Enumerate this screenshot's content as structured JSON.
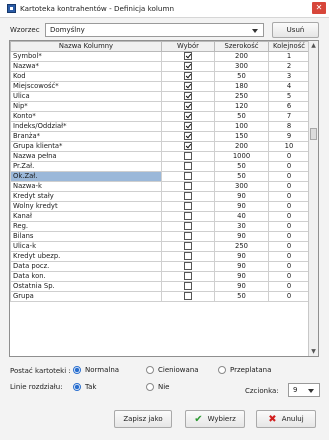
{
  "window": {
    "title": "Kartoteka kontrahentów - Definicja kolumn",
    "close_label": "✕"
  },
  "template": {
    "label": "Wzorzec",
    "value": "Domyślny",
    "delete_button": "Usuń"
  },
  "grid": {
    "headers": [
      "Nazwa Kolumny",
      "Wybór",
      "Szerokość",
      "Kolejność"
    ],
    "rows": [
      {
        "name": "Symbol*",
        "checked": true,
        "width": "200",
        "order": "1"
      },
      {
        "name": "Nazwa*",
        "checked": true,
        "width": "300",
        "order": "2"
      },
      {
        "name": "Kod",
        "checked": true,
        "width": "50",
        "order": "3"
      },
      {
        "name": "Miejscowość*",
        "checked": true,
        "width": "180",
        "order": "4"
      },
      {
        "name": "Ulica",
        "checked": true,
        "width": "250",
        "order": "5"
      },
      {
        "name": "Nip*",
        "checked": true,
        "width": "120",
        "order": "6"
      },
      {
        "name": "Konto*",
        "checked": true,
        "width": "50",
        "order": "7"
      },
      {
        "name": "Indeks/Oddział*",
        "checked": true,
        "width": "100",
        "order": "8"
      },
      {
        "name": "Branża*",
        "checked": true,
        "width": "150",
        "order": "9"
      },
      {
        "name": "Grupa klienta*",
        "checked": true,
        "width": "200",
        "order": "10"
      },
      {
        "name": "Nazwa pełna",
        "checked": false,
        "width": "1000",
        "order": "0"
      },
      {
        "name": "Pr.Zał.",
        "checked": false,
        "width": "50",
        "order": "0"
      },
      {
        "name": "Ok.Zał.",
        "checked": false,
        "width": "50",
        "order": "0",
        "selected": true
      },
      {
        "name": "Nazwa-k",
        "checked": false,
        "width": "300",
        "order": "0"
      },
      {
        "name": "Kredyt stały",
        "checked": false,
        "width": "90",
        "order": "0"
      },
      {
        "name": "Wolny kredyt",
        "checked": false,
        "width": "90",
        "order": "0"
      },
      {
        "name": "Kanał",
        "checked": false,
        "width": "40",
        "order": "0"
      },
      {
        "name": "Reg.",
        "checked": false,
        "width": "30",
        "order": "0"
      },
      {
        "name": "Bilans",
        "checked": false,
        "width": "90",
        "order": "0"
      },
      {
        "name": "Ulica-k",
        "checked": false,
        "width": "250",
        "order": "0"
      },
      {
        "name": "Kredyt ubezp.",
        "checked": false,
        "width": "90",
        "order": "0"
      },
      {
        "name": "Data pocz.",
        "checked": false,
        "width": "90",
        "order": "0"
      },
      {
        "name": "Data kon.",
        "checked": false,
        "width": "90",
        "order": "0"
      },
      {
        "name": "Ostatnia Sp.",
        "checked": false,
        "width": "90",
        "order": "0"
      },
      {
        "name": "Grupa",
        "checked": false,
        "width": "50",
        "order": "0"
      }
    ]
  },
  "options": {
    "postac_label": "Postać kartoteki :",
    "postac_options": [
      {
        "label": "Normalna",
        "selected": true
      },
      {
        "label": "Cieniowana",
        "selected": false
      },
      {
        "label": "Przeplatana",
        "selected": false
      }
    ],
    "linie_label": "Linie rozdziału:",
    "linie_options": [
      {
        "label": "Tak",
        "selected": true
      },
      {
        "label": "Nie",
        "selected": false
      }
    ],
    "font_label": "Czcionka:",
    "font_value": "9"
  },
  "footer": {
    "save_as": "Zapisz jako",
    "choose": "Wybierz",
    "cancel": "Anuluj"
  }
}
